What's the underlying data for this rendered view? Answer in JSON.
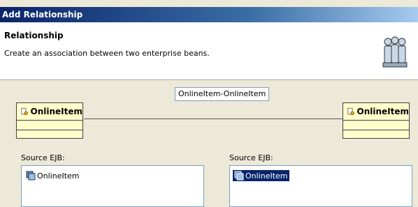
{
  "window": {
    "title": "Add Relationship"
  },
  "header": {
    "title": "Relationship",
    "description": "Create an association between two enterprise beans.",
    "icon": "people-icon"
  },
  "relationship": {
    "name": "OnlineItem-OnlineItem"
  },
  "beans": {
    "left": {
      "name": "OnlineItem",
      "icon": "bean-icon"
    },
    "right": {
      "name": "OnlineItem",
      "icon": "bean-icon"
    }
  },
  "source_left": {
    "label": "Source EJB:",
    "items": [
      "OnlineItem"
    ],
    "selected_index": -1
  },
  "source_right": {
    "label": "Source EJB:",
    "items": [
      "OnlineItem"
    ],
    "selected_index": 0
  },
  "colors": {
    "title_start": "#0a246a",
    "bean_fill": "#ffffcc",
    "selection": "#0a246a",
    "dialog_bg": "#ece9d8"
  }
}
